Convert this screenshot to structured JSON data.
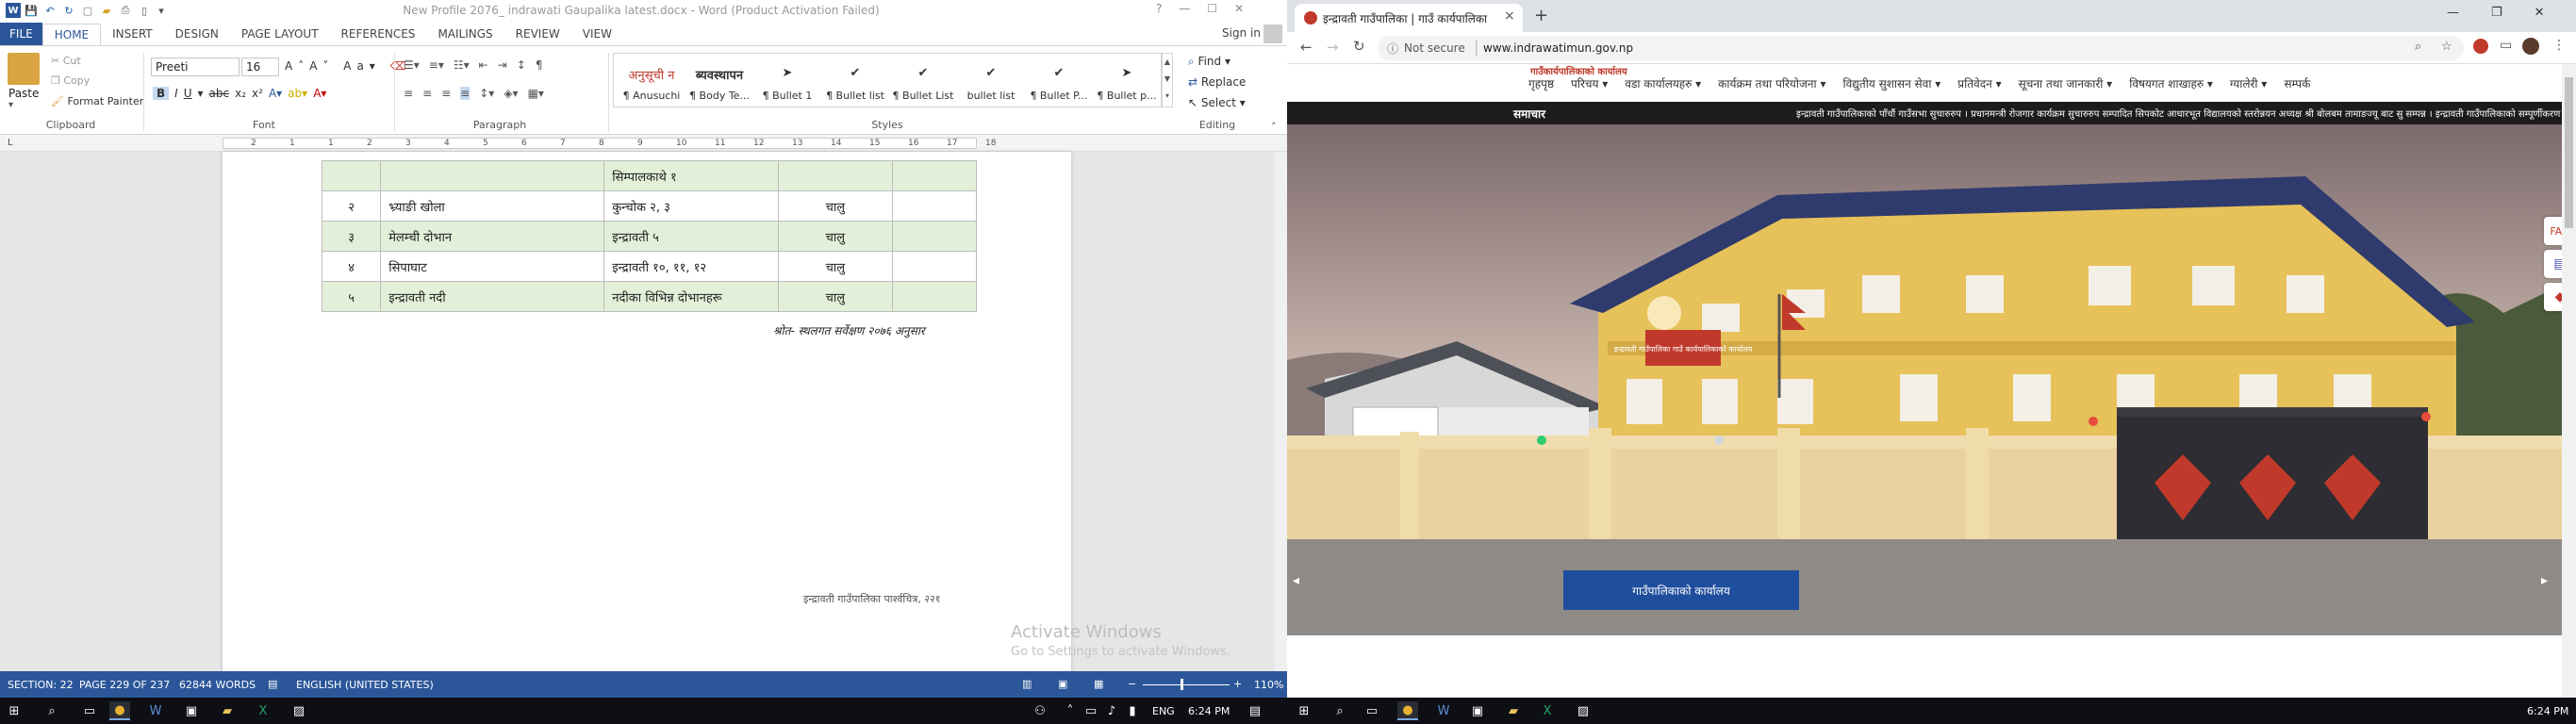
{
  "word": {
    "title": "New Profile 2076_ indrawati Gaupalika latest.docx - Word (Product Activation Failed)",
    "window_controls": [
      "?",
      "—",
      "☐",
      "✕"
    ],
    "tabs": [
      "FILE",
      "HOME",
      "INSERT",
      "DESIGN",
      "PAGE LAYOUT",
      "REFERENCES",
      "MAILINGS",
      "REVIEW",
      "VIEW"
    ],
    "active_tab": "HOME",
    "sign_in": "Sign in",
    "clipboard": {
      "paste": "Paste",
      "cut": "Cut",
      "copy": "Copy",
      "format_painter": "Format Painter",
      "label": "Clipboard"
    },
    "font": {
      "name": "Preeti",
      "size": "16",
      "label": "Font"
    },
    "paragraph_label": "Paragraph",
    "styles_label": "Styles",
    "editing": {
      "find": "Find",
      "replace": "Replace",
      "select": "Select",
      "label": "Editing"
    },
    "styles": [
      {
        "sample": "अनुसूची न",
        "name": "¶ Anusuchi"
      },
      {
        "sample": "ब्यवस्थापन",
        "name": "¶ Body Te..."
      },
      {
        "sample": "➤",
        "name": "¶ Bullet 1"
      },
      {
        "sample": "✔",
        "name": "¶ Bullet list"
      },
      {
        "sample": "✔",
        "name": "¶ Bullet List"
      },
      {
        "sample": "✔",
        "name": "bullet list"
      },
      {
        "sample": "✔",
        "name": "¶ Bullet P..."
      },
      {
        "sample": "➤",
        "name": "¶ Bullet p..."
      }
    ],
    "ruler_numbers": [
      "2",
      "1",
      "1",
      "2",
      "3",
      "4",
      "5",
      "6",
      "7",
      "8",
      "9",
      "10",
      "11",
      "12",
      "13",
      "14",
      "15",
      "16",
      "17",
      "18"
    ],
    "table_rows": [
      {
        "num": "",
        "name": "",
        "place": "सिम्पालकाथे १",
        "status": "",
        "extra": ""
      },
      {
        "num": "२",
        "name": "भ्र्याङी खोला",
        "place": "कुन्चोक २, ३",
        "status": "चालु",
        "extra": ""
      },
      {
        "num": "३",
        "name": "मेलम्ची दोभान",
        "place": "इन्द्रावती ५",
        "status": "चालु",
        "extra": ""
      },
      {
        "num": "४",
        "name": "सिपाघाट",
        "place": "इन्द्रावती १०, ११, १२",
        "status": "चालु",
        "extra": ""
      },
      {
        "num": "५",
        "name": "इन्द्रावती नदी",
        "place": "नदीका विभिन्न दोभानहरू",
        "status": "चालु",
        "extra": ""
      }
    ],
    "source_note": "श्रोत- स्थलगत सर्वेक्षण २०७६ अनुसार",
    "footer_text": "इन्द्रावती गाउँपालिका पार्श्वचित्र,  २२१",
    "watermark_line1": "Activate Windows",
    "watermark_line2": "Go to Settings to activate Windows.",
    "status": {
      "section": "SECTION: 22",
      "page": "PAGE 229 OF 237",
      "words": "62844 WORDS",
      "language": "ENGLISH (UNITED STATES)",
      "zoom": "110%"
    }
  },
  "chrome": {
    "tab_title": "इन्द्रावती गाउँपालिका | गाउँ कार्यपालिका",
    "tab_close": "×",
    "new_tab": "+",
    "not_secure": "Not secure",
    "url": "www.indrawatimun.gov.np",
    "site_logo_text": "गाउँकार्यपालिकाको कार्यालय",
    "nav_items": [
      "गृहपृष्ठ",
      "परिचय ▾",
      "वडा कार्यालयहरु ▾",
      "कार्यक्रम तथा परियोजना ▾",
      "विद्युतीय सुशासन सेवा ▾",
      "प्रतिवेदन ▾",
      "सूचना तथा जानकारी ▾",
      "विषयगत शाखाहरु ▾",
      "ग्यालेरी ▾",
      "सम्पर्क"
    ],
    "news_label": "समाचार",
    "ticker": "इन्द्रावती गाउँपालिकाको पाँचौं गाउँसभा सुचारुरुप ।     प्रधानमन्त्री रोजगार कार्यक्रम सुचारुरुप सम्पादित     सिपकोट आधारभूत विद्यालयको स्तरोन्नयन अध्यक्ष श्री बोलबम तामाङज्यू बाट सु सम्पन्न ।     इन्द्रावती गाउँपालिकाको सम्पूर्णीकरण सम्पन्न",
    "caption": "गाउँपालिकाको कार्यालय",
    "banner_text": "इन्द्रावती गाउँपालिका गाउँ कार्यपालिकाको कार्यालय",
    "side_icons": [
      "faq-icon",
      "chat-icon",
      "alert-icon"
    ]
  },
  "taskbar": {
    "left_time": "6:24 PM",
    "left_lang": "ENG",
    "right_time": "6:24 PM"
  },
  "colors": {
    "word_blue": "#2b579a",
    "status_blue": "#2b579a",
    "green_row": "#e3f0d9",
    "caption_blue": "#1f4e9c",
    "news_bar": "#1c1c1c"
  }
}
